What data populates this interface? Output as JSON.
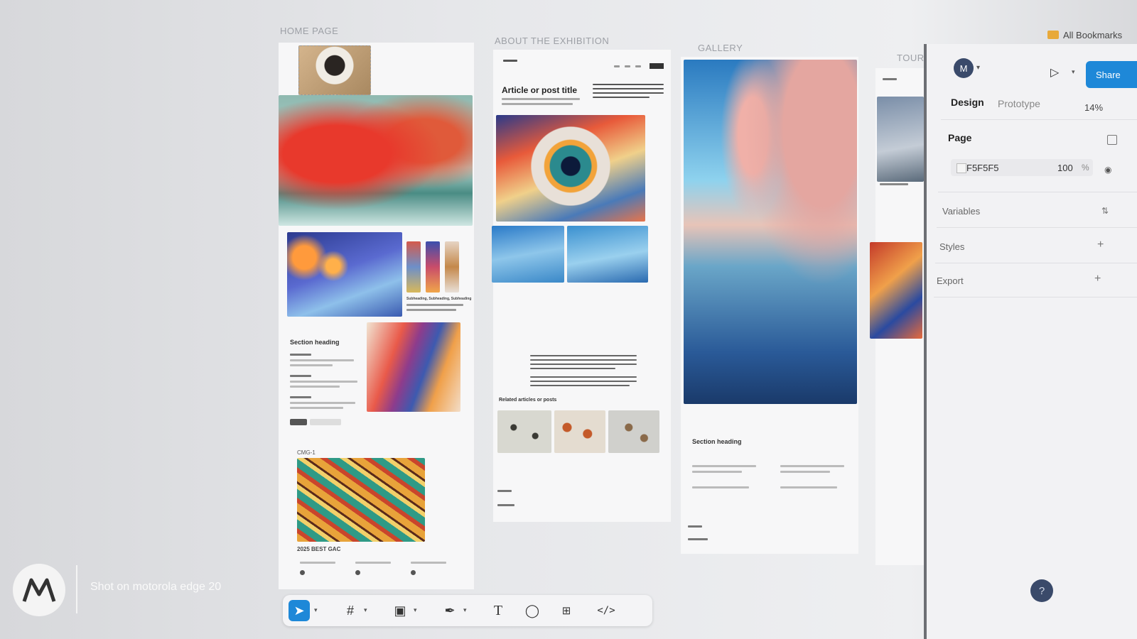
{
  "frames": {
    "home": "HOME PAGE",
    "about": "ABOUT THE EXHIBITION",
    "gallery": "GALLERY",
    "tour": "TOUR"
  },
  "home": {
    "subheading": "Subheading, Subheading, Subheading",
    "section_heading": "Section heading",
    "cmg": "CMG-1",
    "best": "2025 BEST GAC"
  },
  "about": {
    "article_title": "Article or post title",
    "related": "Related articles or posts"
  },
  "gallery": {
    "section_heading": "Section heading"
  },
  "panel": {
    "avatar": "M",
    "share": "Share",
    "tabs": [
      "Design",
      "Prototype"
    ],
    "zoom": "14%",
    "page_label": "Page",
    "fill_hex": "F5F5F5",
    "fill_opacity": "100",
    "fill_pct": "%",
    "variables": "Variables",
    "styles": "Styles",
    "export": "Export"
  },
  "browser": {
    "bookmarks": "All Bookmarks"
  },
  "toolbar": {
    "icons": [
      "move-icon",
      "frame-icon",
      "image-icon",
      "pen-icon",
      "text-icon",
      "comment-icon",
      "components-icon",
      "dev-mode-icon"
    ]
  },
  "watermark": {
    "text": "Shot on motorola edge 20"
  },
  "help": "?",
  "colors": {
    "accent": "#1e88d8",
    "panel_bg": "#f2f2f4"
  }
}
